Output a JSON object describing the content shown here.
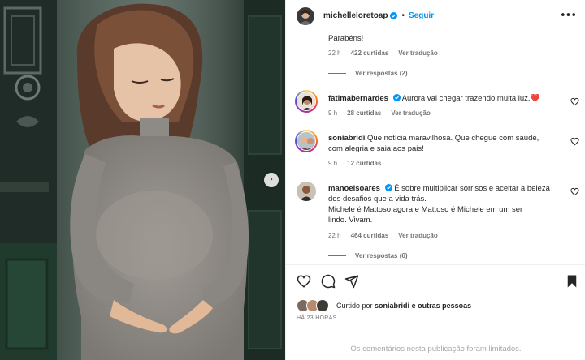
{
  "post": {
    "author": "michelleloretoap",
    "follow_label": "Seguir",
    "separator": "•",
    "more_label": "•••",
    "next_label": "›"
  },
  "comments": [
    {
      "text": "Parabéns!",
      "time": "22 h",
      "likes": "422 curtidas",
      "translate": "Ver tradução",
      "replies": "Ver respostas (2)"
    },
    {
      "user": "fatimabernardes",
      "text": "Aurora vai chegar trazendo muita luz.",
      "emoji": "❤️",
      "time": "9 h",
      "likes": "28 curtidas",
      "translate": "Ver tradução"
    },
    {
      "user": "soniabridi",
      "text_line1": "Que notícia maravilhosa. Que chegue com saúde,",
      "text_line2": "com alegria e saia aos pais!",
      "time": "9 h",
      "likes": "12 curtidas"
    },
    {
      "user": "manoelsoares",
      "text_line1": "É sobre multiplicar sorrisos e aceitar a beleza",
      "text_line2": "dos desafios que a vida trás.",
      "text_line3": "Michele é Mattoso agora e Mattoso é Michele em um ser",
      "text_line4": "lindo. Vivam.",
      "time": "22 h",
      "likes": "464 curtidas",
      "translate": "Ver tradução",
      "replies": "Ver respostas (6)"
    }
  ],
  "likes_summary": {
    "prefix": "Curtido por",
    "user": "soniabridi",
    "suffix": "e outras pessoas"
  },
  "posted_ago": "HÁ 23 HORAS",
  "comments_limited": "Os comentários nesta publicação foram limitados.",
  "colors": {
    "accent": "#0095f6",
    "verified": "#0095f6",
    "heart": "#ed4956"
  },
  "icons": [
    "more-icon",
    "next-arrow-icon",
    "heart-icon",
    "comment-icon",
    "share-icon",
    "bookmark-icon",
    "verified-icon"
  ]
}
